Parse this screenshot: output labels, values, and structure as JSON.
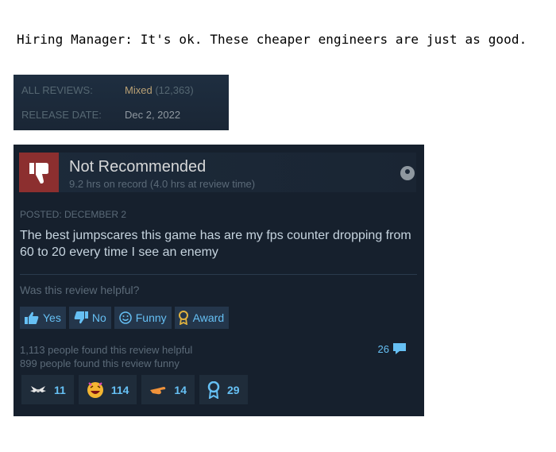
{
  "caption": "Hiring Manager: It's ok. These cheaper engineers are just as good.",
  "summary": {
    "all_reviews_key": "ALL REVIEWS:",
    "all_reviews_value": "Mixed",
    "all_reviews_count": "(12,363)",
    "release_key": "RELEASE DATE:",
    "release_value": "Dec 2, 2022"
  },
  "review": {
    "title": "Not Recommended",
    "hours": "9.2 hrs on record (4.0 hrs at review time)",
    "posted": "POSTED: DECEMBER 2",
    "body": "The best jumpscares this game has are my fps counter dropping from 60 to 20 every time I see an enemy",
    "helpful_prompt": "Was this review helpful?",
    "buttons": {
      "yes": "Yes",
      "no": "No",
      "funny": "Funny",
      "award": "Award"
    },
    "stats_helpful": "1,113 people found this review helpful",
    "stats_funny": "899 people found this review funny",
    "comments": "26",
    "awards": [
      {
        "icon": "wings-icon",
        "count": "11"
      },
      {
        "icon": "laughing-face-icon",
        "count": "114"
      },
      {
        "icon": "hand-icon",
        "count": "14"
      },
      {
        "icon": "medal-icon",
        "count": "29"
      }
    ]
  }
}
